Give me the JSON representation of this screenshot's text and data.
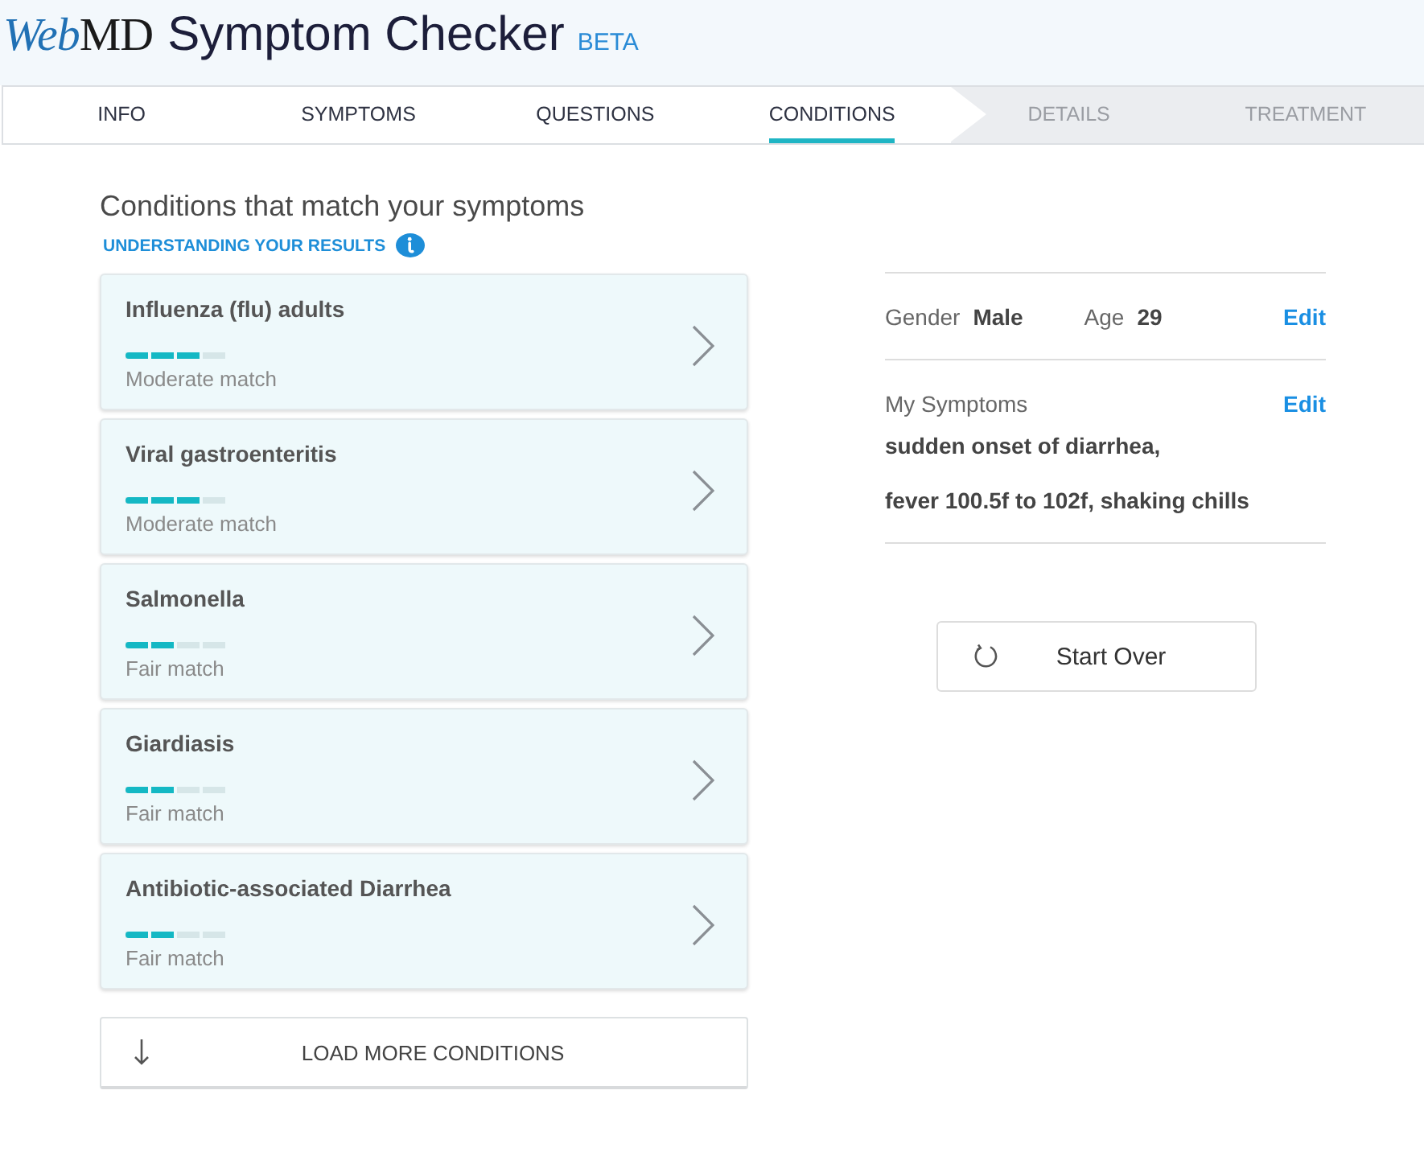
{
  "header": {
    "logo": {
      "part_1": "Web",
      "part_2": "MD"
    },
    "title": "Symptom Checker",
    "badge": "BETA"
  },
  "tabs": [
    {
      "label": "INFO",
      "selected": false,
      "disabled": false
    },
    {
      "label": "SYMPTOMS",
      "selected": false,
      "disabled": false
    },
    {
      "label": "QUESTIONS",
      "selected": false,
      "disabled": false
    },
    {
      "label": "CONDITIONS",
      "selected": true,
      "disabled": false
    },
    {
      "label": "DETAILS",
      "selected": false,
      "disabled": true
    },
    {
      "label": "TREATMENT",
      "selected": false,
      "disabled": true
    }
  ],
  "results": {
    "heading": "Conditions that match your symptoms",
    "help_link": "UNDERSTANDING YOUR RESULTS",
    "conditions": [
      {
        "name": "Influenza (flu) adults",
        "level": 0.75,
        "match": "Moderate match"
      },
      {
        "name": "Viral gastroenteritis",
        "level": 0.75,
        "match": "Moderate match"
      },
      {
        "name": "Salmonella",
        "level": 0.5,
        "match": "Fair match"
      },
      {
        "name": "Giardiasis",
        "level": 0.5,
        "match": "Fair match"
      },
      {
        "name": "Antibiotic-associated Diarrhea",
        "level": 0.5,
        "match": "Fair match"
      }
    ],
    "load_more": "LOAD MORE CONDITIONS"
  },
  "profile": {
    "gender_label": "Gender",
    "gender": "Male",
    "age_label": "Age",
    "age": "29",
    "edit": "Edit"
  },
  "symptoms": {
    "label": "My Symptoms",
    "edit": "Edit",
    "items": [
      "sudden onset of diarrhea,",
      "fever 100.5f to 102f, shaking chills"
    ]
  },
  "start_over": "Start Over"
}
